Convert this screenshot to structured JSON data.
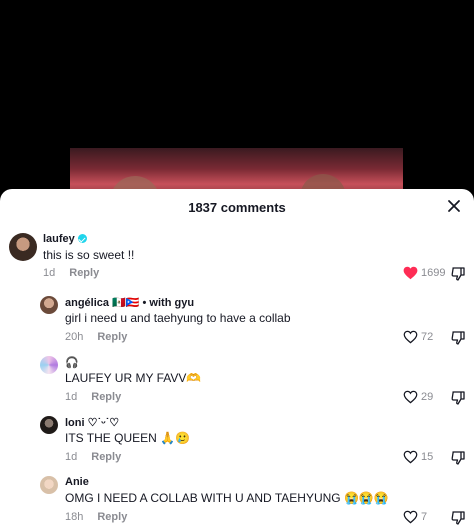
{
  "comments_panel": {
    "count_label": "1837 comments"
  },
  "comments": [
    {
      "user": "laufey",
      "text": "this is so sweet !!",
      "time": "1d",
      "reply_label": "Reply",
      "likes": "1699"
    },
    {
      "user": "angélica 🇲🇽🇵🇷 • with gyu",
      "text": "girl i need u and taehyung to have a collab",
      "time": "20h",
      "reply_label": "Reply",
      "likes": "72"
    },
    {
      "user": "🎧",
      "text": "LAUFEY UR MY FAVV🫶",
      "time": "1d",
      "reply_label": "Reply",
      "likes": "29"
    },
    {
      "user": "loni ♡˙ᵕ˙♡",
      "text": "ITS THE QUEEN 🙏🥲",
      "time": "1d",
      "reply_label": "Reply",
      "likes": "15"
    },
    {
      "user": "Anie",
      "text": "OMG I NEED A COLLAB WITH U AND TAEHYUNG 😭😭😭",
      "time": "18h",
      "reply_label": "Reply",
      "likes": "7"
    }
  ],
  "colors": {
    "liked_heart": "#fe2c55",
    "verified": "#20d5ec"
  }
}
